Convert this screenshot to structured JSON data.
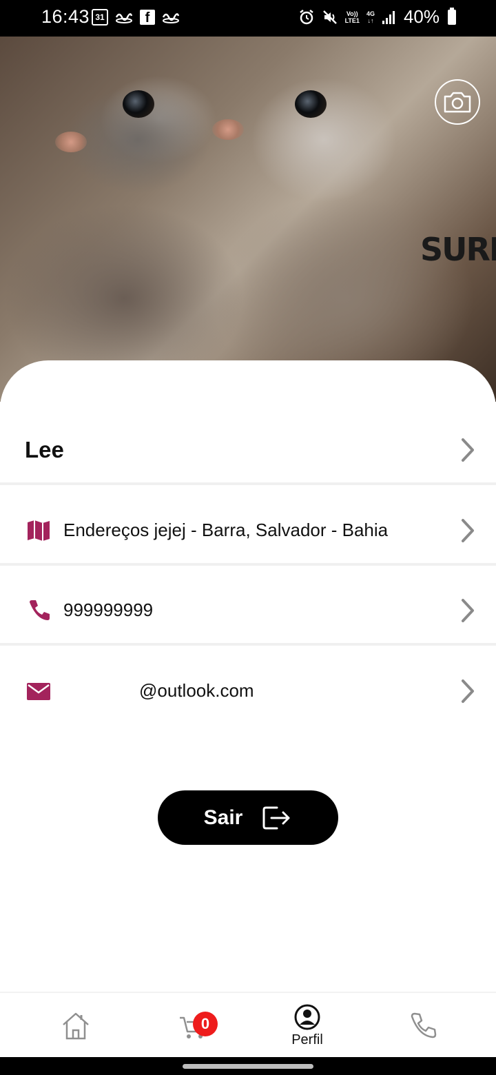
{
  "status_bar": {
    "time": "16:43",
    "calendar_day": "31",
    "network_top": "Vo))",
    "network_bottom": "LTE1",
    "network_type": "4G",
    "battery": "40%"
  },
  "hero": {
    "watermark": "SURIC"
  },
  "profile": {
    "name": "Lee",
    "address": "Endereços jejej - Barra, Salvador - Bahia",
    "phone": "999999999",
    "email": "@outlook.com"
  },
  "actions": {
    "logout_label": "Sair"
  },
  "bottom_nav": {
    "cart_count": "0",
    "profile_label": "Perfil"
  },
  "colors": {
    "accent": "#a3235c",
    "badge": "#ee1c1c",
    "button": "#000000"
  },
  "icons": [
    "camera-icon",
    "map-icon",
    "phone-icon",
    "mail-icon",
    "chevron-right-icon",
    "logout-icon",
    "home-icon",
    "cart-icon",
    "user-circle-icon",
    "call-icon"
  ]
}
